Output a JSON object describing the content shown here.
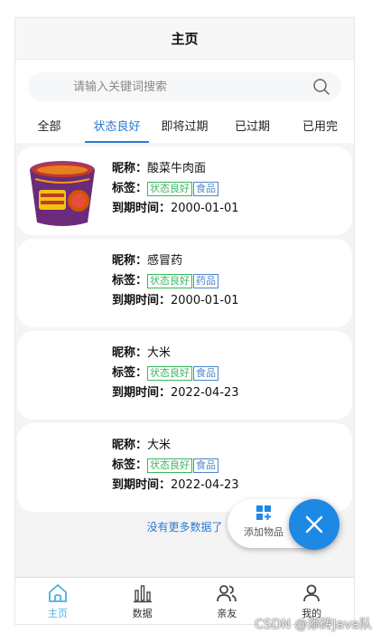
{
  "header": {
    "title": "主页"
  },
  "search": {
    "placeholder": "请输入关键词搜索",
    "value": ""
  },
  "tabs": [
    {
      "label": "全部"
    },
    {
      "label": "状态良好"
    },
    {
      "label": "即将过期"
    },
    {
      "label": "已过期"
    },
    {
      "label": "已用完"
    }
  ],
  "active_tab": "状态良好",
  "field_labels": {
    "name": "昵称：",
    "tag": "标签：",
    "expire": "到期时间："
  },
  "items": [
    {
      "name": "酸菜牛肉面",
      "status_tag": "状态良好",
      "category_tag": "食品",
      "expire": "2000-01-01",
      "has_image": true
    },
    {
      "name": "感冒药",
      "status_tag": "状态良好",
      "category_tag": "药品",
      "expire": "2000-01-01",
      "has_image": false
    },
    {
      "name": "大米",
      "status_tag": "状态良好",
      "category_tag": "食品",
      "expire": "2022-04-23",
      "has_image": false
    },
    {
      "name": "大米",
      "status_tag": "状态良好",
      "category_tag": "食品",
      "expire": "2022-04-23",
      "has_image": false
    }
  ],
  "no_more_text": "没有更多数据了",
  "fab": {
    "add_label": "添加物品"
  },
  "bottom_nav": [
    {
      "label": "主页",
      "icon": "home-icon"
    },
    {
      "label": "数据",
      "icon": "chart-icon"
    },
    {
      "label": "亲友",
      "icon": "friends-icon"
    },
    {
      "label": "我的",
      "icon": "user-icon"
    }
  ],
  "watermark": "CSDN @添砖Java队",
  "colors": {
    "accent": "#2a7bd4",
    "tag_green": "#3cb55e",
    "tag_blue": "#4e86c9",
    "fab": "#1e88e5",
    "nav_active": "#4ab0e8"
  }
}
